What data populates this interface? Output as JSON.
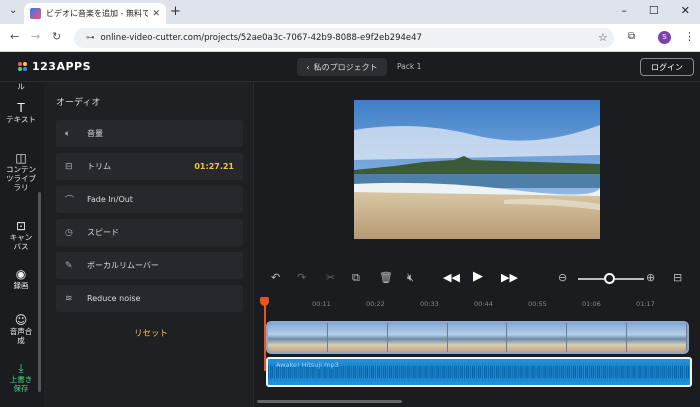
{
  "browser": {
    "tab_title": "ビデオに音楽を追加 - 無料でビデオ",
    "url": "online-video-cutter.com/projects/52ae0a3c-7067-42b9-8088-e9f2eb294e47",
    "profile_initial": "S"
  },
  "header": {
    "logo_text": "123APPS",
    "back_label": "私のプロジェクト",
    "pack_label": "Pack 1",
    "login_label": "ログイン"
  },
  "sidebar": {
    "items": [
      {
        "label": "ル",
        "icon": "partial-icon"
      },
      {
        "label": "テキスト",
        "icon": "text-icon"
      },
      {
        "label": "コンテンツライブラリ",
        "icon": "library-icon"
      },
      {
        "label": "キャンバス",
        "icon": "canvas-icon"
      },
      {
        "label": "録画",
        "icon": "record-icon"
      },
      {
        "label": "音声合成",
        "icon": "tts-icon"
      },
      {
        "label": "上書き保存",
        "icon": "save-icon"
      }
    ]
  },
  "panel": {
    "title": "オーディオ",
    "options": [
      {
        "label": "音量",
        "icon": "volume-icon",
        "value": ""
      },
      {
        "label": "トリム",
        "icon": "trim-icon",
        "value": "01:27.21"
      },
      {
        "label": "Fade In/Out",
        "icon": "fade-icon",
        "value": ""
      },
      {
        "label": "スピード",
        "icon": "speed-icon",
        "value": ""
      },
      {
        "label": "ボーカルリムーバー",
        "icon": "vocal-remover-icon",
        "value": ""
      },
      {
        "label": "Reduce noise",
        "icon": "noise-icon",
        "value": ""
      }
    ],
    "reset_label": "リセット"
  },
  "timeline": {
    "ticks": [
      "00:11",
      "00:22",
      "00:33",
      "00:44",
      "00:55",
      "01:06",
      "01:17"
    ],
    "audio_label": "Awake! Hitsuji.mp3",
    "zoom_level": 0.4
  },
  "colors": {
    "accent": "#f5c542",
    "playhead": "#e8541f",
    "audio_track": "#1e8fd8",
    "save_green": "#3ddc84"
  }
}
